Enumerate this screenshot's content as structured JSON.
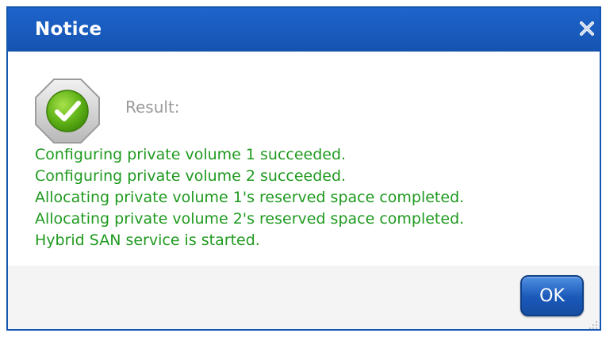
{
  "dialog": {
    "title": "Notice",
    "result_label": "Result:",
    "messages": [
      "Configuring private volume 1 succeeded.",
      "Configuring private volume 2 succeeded.",
      "Allocating private volume 1's reserved space completed.",
      "Allocating private volume 2's reserved space completed.",
      "Hybrid SAN service is started."
    ],
    "ok_label": "OK",
    "icons": {
      "close": "close-icon",
      "status": "success-check-icon",
      "resize": "resize-grip-icon"
    },
    "colors": {
      "titlebar": "#1556b5",
      "message_text": "#1f9a1f",
      "result_label": "#9a9a9a",
      "ok_button": "#1a58b8"
    }
  }
}
